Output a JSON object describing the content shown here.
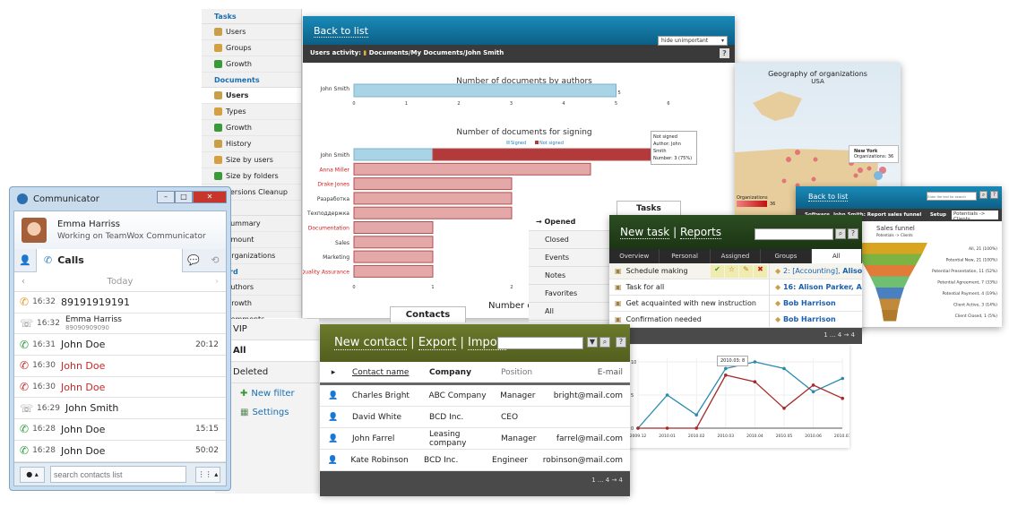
{
  "sidebar": {
    "sections": [
      {
        "title": "Tasks",
        "items": [
          "Users",
          "Groups",
          "Growth"
        ]
      },
      {
        "title": "Documents",
        "items": [
          "Users",
          "Types",
          "Growth",
          "History",
          "Size by users",
          "Size by folders",
          "Versions Cleanup"
        ]
      },
      {
        "title": "Mail",
        "items": [
          "Summary",
          "Amount",
          "Organizations"
        ]
      },
      {
        "title": "Board",
        "items": [
          "Authors",
          "Growth",
          "Comments"
        ]
      },
      {
        "title": "Organizations",
        "items": []
      }
    ],
    "selected": "Users"
  },
  "report": {
    "back_link": "Back to list",
    "activity_label": "Users activity:",
    "path": "Documents/My Documents/John Smith",
    "filter": "hide unimportant",
    "help": "?",
    "tooltip": {
      "line1": "Not signed",
      "line2": "Author: John Smith",
      "line3": "Number: 3 (75%)"
    },
    "third_title": "Number of"
  },
  "chart_data": [
    {
      "type": "bar",
      "orientation": "horizontal",
      "title": "Number of documents by authors",
      "categories": [
        "John Smith"
      ],
      "values": [
        5
      ],
      "xlim": [
        0,
        6
      ],
      "ticks": [
        0,
        1,
        2,
        3,
        4,
        5,
        6
      ],
      "data_labels": [
        "5"
      ],
      "colors": {
        "bar": "#a8d4e6"
      }
    },
    {
      "type": "bar",
      "orientation": "horizontal",
      "stacked": true,
      "title": "Number of documents for signing",
      "legend_position": "top",
      "categories": [
        "John Smith",
        "Anna Miller",
        "Drake Jones",
        "Разработка",
        "Техподдержка",
        "Documentation",
        "Sales",
        "Marketing",
        "Quality Assurance"
      ],
      "highlighted_categories": [
        "Anna Miller",
        "Drake Jones",
        "Documentation",
        "Quality Assurance"
      ],
      "series": [
        {
          "name": "Signed",
          "values": [
            1,
            0,
            0,
            0,
            0,
            0,
            0,
            0,
            0
          ],
          "color": "#a8d4e6"
        },
        {
          "name": "Not signed",
          "values": [
            3,
            3,
            2,
            2,
            2,
            1,
            1,
            1,
            1
          ],
          "color": "#b23a3a"
        }
      ],
      "ticks": [
        0,
        1,
        2
      ]
    },
    {
      "type": "line",
      "categories": [
        "2009.12",
        "2010.01",
        "2010.02",
        "2010.03",
        "2010.04",
        "2010.05",
        "2010.06",
        "2010.07"
      ],
      "yticks": [
        0,
        5,
        10
      ],
      "ylim": [
        0,
        11
      ],
      "grid": true,
      "series": [
        {
          "values": [
            0,
            5,
            2,
            9,
            10,
            9,
            5.5,
            7.5
          ],
          "color": "#2a8aad"
        },
        {
          "values": [
            0,
            0,
            0,
            8,
            7,
            3,
            6.5,
            4.5
          ],
          "color": "#a52a2a"
        }
      ],
      "tooltip": "2010.03: 8"
    },
    {
      "type": "funnel",
      "title": "Sales funnel",
      "subtitle": "Potentials -> Clients",
      "labels": [
        "All, 21 (100%)",
        "Potential New, 21 (100%)",
        "Potential Presentation, 11 (52%)",
        "Potential Agreement, 7 (33%)",
        "Potential Payment, 4 (19%)",
        "Client Active, 3 (14%)",
        "Client Closed, 1 (5%)"
      ],
      "colors": [
        "#d9a520",
        "#7cb342",
        "#e07b39",
        "#6fbf73",
        "#4a7fc0",
        "#c08a3a",
        "#b07a2a"
      ]
    }
  ],
  "map": {
    "title": "Geography of organizations",
    "subtitle": "USA",
    "tooltip_city": "New York",
    "tooltip_value": "Organizations: 36",
    "legend_label": "Organizations",
    "legend_max": "36"
  },
  "tasks": {
    "tab": "Tasks",
    "filters": [
      "Opened",
      "Closed",
      "Events",
      "Notes",
      "Favorites",
      "All"
    ],
    "new_task": "New task",
    "reports": "Reports",
    "sep": "|",
    "help": "?",
    "tabs": [
      "Overview",
      "Personal",
      "Assigned",
      "Groups",
      "All"
    ],
    "rows": [
      {
        "name": "Schedule making",
        "assignee_prefix": "2: [Accounting], ",
        "assignee": "Alison Pa"
      },
      {
        "name": "Task for all",
        "assignee_prefix": "16: ",
        "assignee": "Alison Parker, Anna"
      },
      {
        "name": "Get acquainted with new instruction",
        "assignee_prefix": "",
        "assignee": "Bob Harrison"
      },
      {
        "name": "Confirmation needed",
        "assignee_prefix": "",
        "assignee": "Bob Harrison"
      }
    ],
    "pager": "1 ... 4 → 4"
  },
  "funnel_panel": {
    "back_link": "Back to list",
    "search_placeholder": "Enter the text for search",
    "title": "Software, John Smith: Report sales funnel",
    "setup": "Setup",
    "select": "Potentials -> Clients",
    "help": "?"
  },
  "contacts": {
    "tab": "Contacts",
    "filters": [
      "VIP",
      "All",
      "Deleted"
    ],
    "new_filter": "New filter",
    "settings": "Settings",
    "new_contact": "New contact",
    "export": "Export",
    "import": "Import",
    "sep": "|",
    "help": "?",
    "columns": [
      "Contact name",
      "Company",
      "Position",
      "E-mail"
    ],
    "rows": [
      [
        "Charles Bright",
        "ABC Company",
        "Manager",
        "bright@mail.com"
      ],
      [
        "David White",
        "BCD Inc.",
        "CEO",
        ""
      ],
      [
        "John Farrel",
        "Leasing company",
        "Manager",
        "farrel@mail.com"
      ],
      [
        "Kate Robinson",
        "BCD Inc.",
        "Engineer",
        "robinson@mail.com"
      ]
    ],
    "pager": "1 ... 4 → 4"
  },
  "communicator": {
    "title": "Communicator",
    "user": "Emma Harriss",
    "status": "Working on TeamWox Communicator",
    "tab": "Calls",
    "day": "Today",
    "calls": [
      {
        "time": "16:32",
        "name": "89191919191",
        "sub": "",
        "duration": "",
        "type": "forwarded",
        "color": "#e8962a",
        "missed": false
      },
      {
        "time": "16:32",
        "name": "Emma Harriss",
        "sub": "89090909090",
        "duration": "",
        "type": "scheduled",
        "color": "#888",
        "missed": false
      },
      {
        "time": "16:31",
        "name": "John Doe",
        "sub": "",
        "duration": "20:12",
        "type": "incoming",
        "color": "#2a9a3a",
        "missed": false
      },
      {
        "time": "16:30",
        "name": "John Doe",
        "sub": "",
        "duration": "",
        "type": "missed",
        "color": "#c62828",
        "missed": true
      },
      {
        "time": "16:30",
        "name": "John Doe",
        "sub": "",
        "duration": "",
        "type": "missed",
        "color": "#c62828",
        "missed": true
      },
      {
        "time": "16:29",
        "name": "John Smith",
        "sub": "",
        "duration": "",
        "type": "scheduled",
        "color": "#888",
        "missed": false
      },
      {
        "time": "16:28",
        "name": "John Doe",
        "sub": "",
        "duration": "15:15",
        "type": "incoming",
        "color": "#2a9a3a",
        "missed": false
      },
      {
        "time": "16:28",
        "name": "John Doe",
        "sub": "",
        "duration": "50:02",
        "type": "incoming",
        "color": "#2a9a3a",
        "missed": false
      }
    ],
    "search_placeholder": "search contacts list"
  }
}
